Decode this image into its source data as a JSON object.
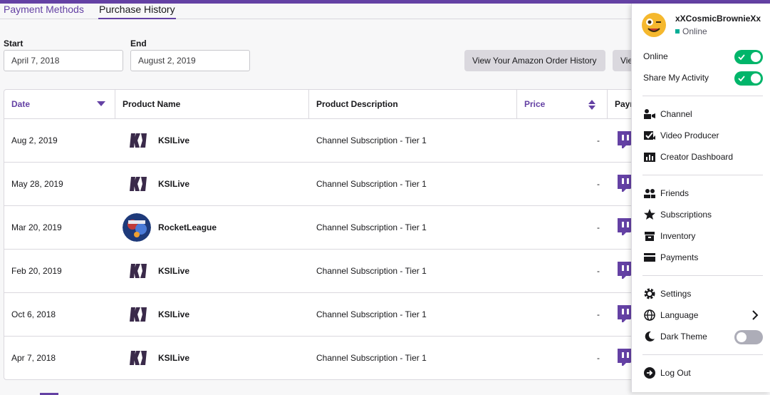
{
  "tabs": [
    {
      "label": "Payment Methods"
    },
    {
      "label": "Purchase History"
    }
  ],
  "filters": {
    "start_label": "Start",
    "start_value": "April 7, 2018",
    "end_label": "End",
    "end_value": "August 2, 2019"
  },
  "buttons": {
    "amazon": "View Your Amazon Order History",
    "second": "View Your Twitch Order History"
  },
  "table": {
    "headers": {
      "date": "Date",
      "product": "Product Name",
      "description": "Product Description",
      "price": "Price",
      "payment": "Payment Method"
    },
    "rows": [
      {
        "date": "Aug 2, 2019",
        "product": "KSILive",
        "description": "Channel Subscription - Tier 1",
        "price": "-"
      },
      {
        "date": "May 28, 2019",
        "product": "KSILive",
        "description": "Channel Subscription - Tier 1",
        "price": "-"
      },
      {
        "date": "Mar 20, 2019",
        "product": "RocketLeague",
        "description": "Channel Subscription - Tier 1",
        "price": "-"
      },
      {
        "date": "Feb 20, 2019",
        "product": "KSILive",
        "description": "Channel Subscription - Tier 1",
        "price": "-"
      },
      {
        "date": "Oct 6, 2018",
        "product": "KSILive",
        "description": "Channel Subscription - Tier 1",
        "price": "-"
      },
      {
        "date": "Apr 7, 2018",
        "product": "KSILive",
        "description": "Channel Subscription - Tier 1",
        "price": "-"
      }
    ]
  },
  "menu": {
    "username": "xXCosmicBrownieXx",
    "status": "Online",
    "toggles": {
      "online_label": "Online",
      "online_on": true,
      "activity_label": "Share My Activity",
      "activity_on": true,
      "dark_label": "Dark Theme",
      "dark_on": false
    },
    "items": {
      "channel": "Channel",
      "video_producer": "Video Producer",
      "creator_dashboard": "Creator Dashboard",
      "friends": "Friends",
      "subscriptions": "Subscriptions",
      "inventory": "Inventory",
      "payments": "Payments",
      "settings": "Settings",
      "language": "Language",
      "logout": "Log Out"
    }
  },
  "colors": {
    "accent": "#6441a4",
    "toggle_on": "#00b56a",
    "toggle_off": "#adadb8",
    "online_dot": "#00ad96"
  },
  "icons": {
    "avatar": "winking-emoji-avatar",
    "payment": "twitch-logo-icon"
  }
}
